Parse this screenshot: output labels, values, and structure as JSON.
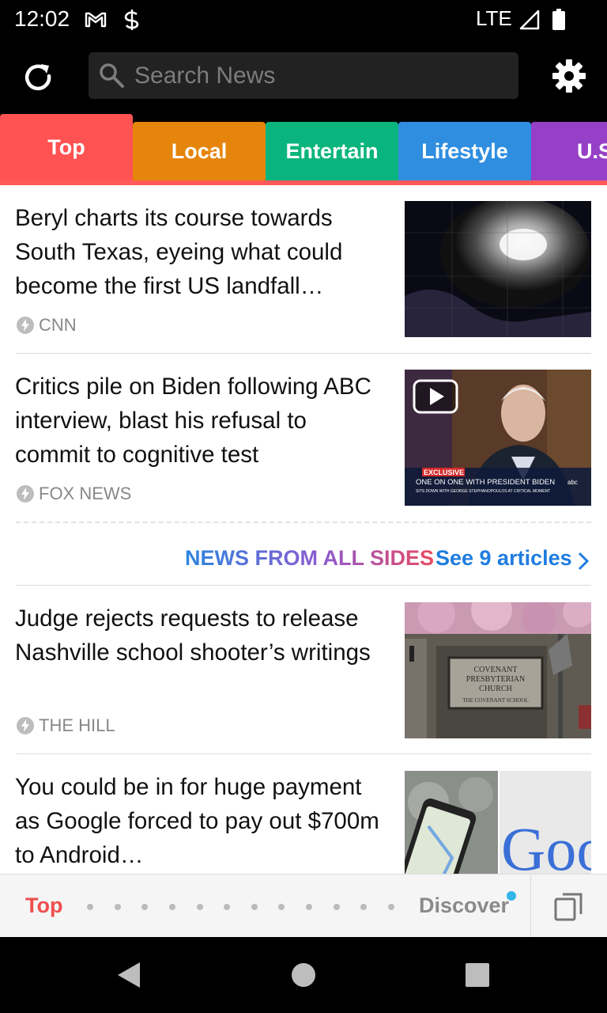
{
  "status": {
    "time": "12:02",
    "network": "LTE",
    "icons": [
      "gmail-icon",
      "sync-icon",
      "signal-icon",
      "battery-icon"
    ]
  },
  "app_bar": {
    "search_placeholder": "Search News",
    "icons": [
      "refresh-icon",
      "search-icon",
      "settings-icon"
    ]
  },
  "tabs": [
    {
      "label": "Top",
      "color": "#ff5252",
      "active": true
    },
    {
      "label": "Local",
      "color": "#e5850b",
      "active": false
    },
    {
      "label": "Entertain",
      "color": "#0ab57d",
      "active": false
    },
    {
      "label": "Lifestyle",
      "color": "#2f8ee0",
      "active": false
    },
    {
      "label": "U.S",
      "color": "#9640c8",
      "active": false
    }
  ],
  "articles": [
    {
      "headline": "Beryl charts its course towards South Texas, eyeing what could become the first US landfall…",
      "source": "CNN",
      "thumbnail": "hurricane-satellite-image"
    },
    {
      "headline": "Critics pile on Biden following ABC interview, blast his refusal to commit to cognitive test",
      "source": "FOX NEWS",
      "thumbnail": "interview-video-still",
      "video": true,
      "overlay": {
        "badge": "EXCLUSIVE",
        "title": "ONE ON ONE WITH PRESIDENT BIDEN",
        "subtitle": "SITS DOWN WITH GEORGE STEPHANOPOULOS AT CRITICAL MOMENT",
        "logo": "abc"
      }
    },
    {
      "headline": "Judge rejects requests to release Nashville school shooter’s writings",
      "source": "THE HILL",
      "thumbnail": "church-sign-photo",
      "sign_lines": [
        "COVENANT",
        "PRESBYTERIAN",
        "CHURCH",
        "THE COVENANT SCHOOL"
      ]
    },
    {
      "headline": "You could be in for huge payment as Google forced to pay out $700m to Android…",
      "source": "",
      "thumbnail": "google-phone-image",
      "logo_text": "Goog"
    }
  ],
  "all_sides": {
    "label": "NEWS FROM ALL SIDES",
    "link": "See 9 articles"
  },
  "bottom_bar": {
    "top_label": "Top",
    "discover_label": "Discover",
    "page_dots": 12,
    "accent": "#f04e4e",
    "badge_color": "#35b6e8"
  }
}
